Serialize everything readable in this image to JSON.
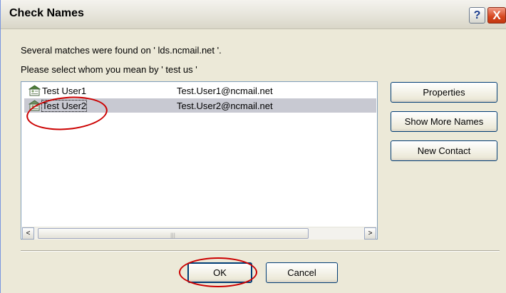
{
  "dialog": {
    "title": "Check Names",
    "message_line1": "Several matches were found on ' lds.ncmail.net '.",
    "message_line2": "Please select whom you mean by ' test us '"
  },
  "titlebar_buttons": {
    "help": "?",
    "close": "X"
  },
  "matches": [
    {
      "name": "Test User1",
      "email": "Test.User1@ncmail.net",
      "icon": "address-card-icon",
      "selected": false
    },
    {
      "name": "Test User2",
      "email": "Test.User2@ncmail.net",
      "icon": "address-card-icon",
      "selected": true
    }
  ],
  "side_buttons": {
    "properties": "Properties",
    "show_more_names": "Show More Names",
    "new_contact": "New Contact"
  },
  "scrollbar": {
    "left_arrow": "<",
    "right_arrow": ">",
    "grip": "|||"
  },
  "bottom_buttons": {
    "ok": "OK",
    "cancel": "Cancel"
  },
  "colors": {
    "annotation": "#cc0000",
    "selection": "#c8c9d2",
    "dialog_bg": "#ece9d8"
  }
}
